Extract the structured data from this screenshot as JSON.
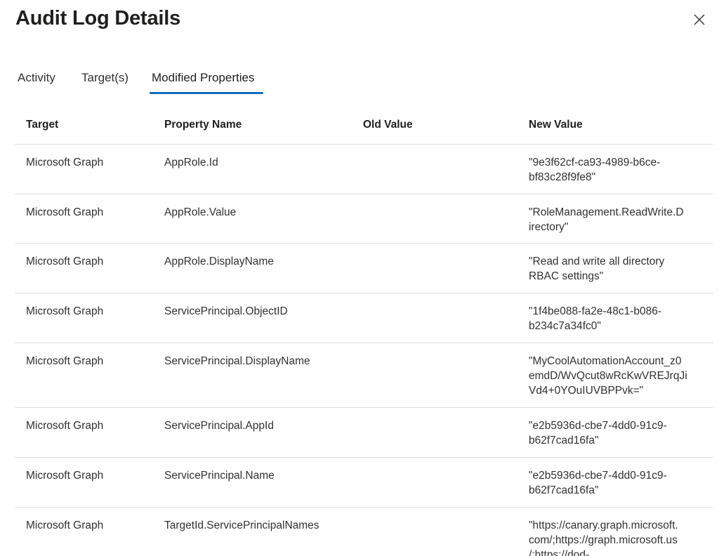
{
  "header": {
    "title": "Audit Log Details"
  },
  "tabs": [
    {
      "label": "Activity",
      "active": false
    },
    {
      "label": "Target(s)",
      "active": false
    },
    {
      "label": "Modified Properties",
      "active": true
    }
  ],
  "table": {
    "columns": [
      "Target",
      "Property Name",
      "Old Value",
      "New Value"
    ],
    "rows": [
      {
        "target": "Microsoft Graph",
        "property": "AppRole.Id",
        "old": "",
        "new_lines": [
          "\"9e3f62cf-ca93-4989-b6ce-",
          "bf83c28f9fe8\""
        ]
      },
      {
        "target": "Microsoft Graph",
        "property": "AppRole.Value",
        "old": "",
        "new_lines": [
          "\"RoleManagement.ReadWrite.D",
          "irectory\""
        ]
      },
      {
        "target": "Microsoft Graph",
        "property": "AppRole.DisplayName",
        "old": "",
        "new_lines": [
          "\"Read and write all directory",
          "RBAC settings\""
        ]
      },
      {
        "target": "Microsoft Graph",
        "property": "ServicePrincipal.ObjectID",
        "old": "",
        "new_lines": [
          "\"1f4be088-fa2e-48c1-b086-",
          "b234c7a34fc0\""
        ]
      },
      {
        "target": "Microsoft Graph",
        "property": "ServicePrincipal.DisplayName",
        "old": "",
        "new_lines": [
          "\"MyCoolAutomationAccount_z0",
          "emdD/WvQcut8wRcKwVREJrqJi",
          "Vd4+0YOuIUVBPPvk=\""
        ]
      },
      {
        "target": "Microsoft Graph",
        "property": "ServicePrincipal.AppId",
        "old": "",
        "new_lines": [
          "\"e2b5936d-cbe7-4dd0-91c9-",
          "b62f7cad16fa\""
        ]
      },
      {
        "target": "Microsoft Graph",
        "property": "ServicePrincipal.Name",
        "old": "",
        "new_lines": [
          "\"e2b5936d-cbe7-4dd0-91c9-",
          "b62f7cad16fa\""
        ]
      },
      {
        "target": "Microsoft Graph",
        "property": "TargetId.ServicePrincipalNames",
        "old": "",
        "new_lines": [
          "\"https://canary.graph.microsoft.",
          "com/;https://graph.microsoft.us",
          "/;https://dod-"
        ]
      }
    ]
  },
  "icons": {
    "close": "close-icon"
  },
  "colors": {
    "accent": "#0f6cbd",
    "divider": "#e1dfdd",
    "text": "#201f1e"
  }
}
